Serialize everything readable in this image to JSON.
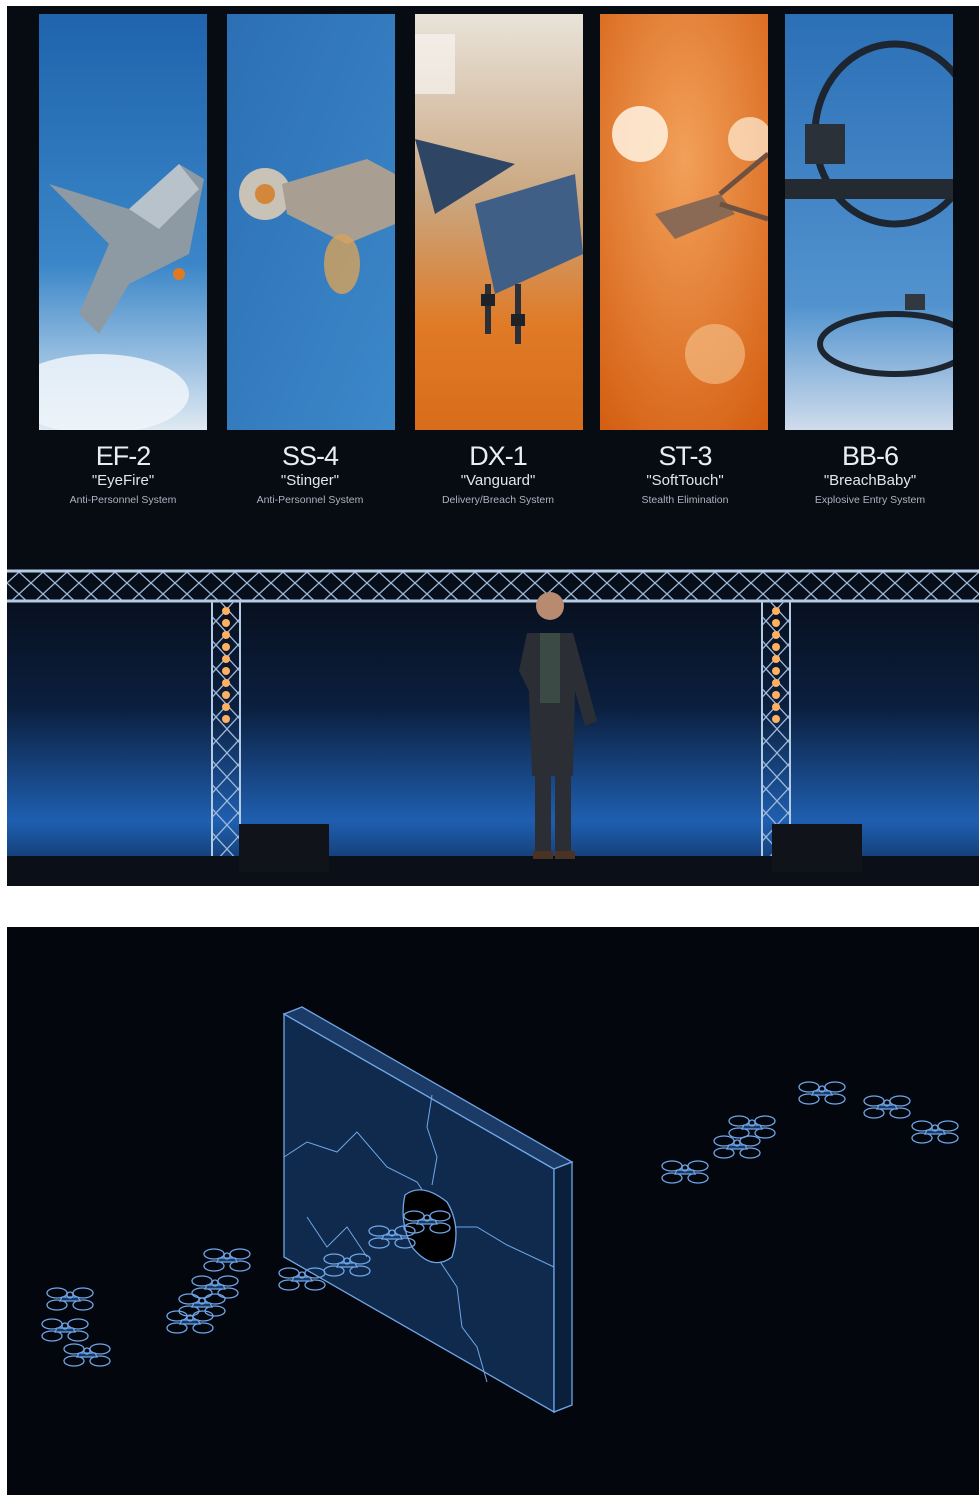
{
  "panels": [
    {
      "code": "EF-2",
      "nickname": "\"EyeFire\"",
      "description": "Anti-Personnel System",
      "bg": "#2a6db0"
    },
    {
      "code": "SS-4",
      "nickname": "\"Stinger\"",
      "description": "Anti-Personnel System",
      "bg": "#2f74b8"
    },
    {
      "code": "DX-1",
      "nickname": "\"Vanguard\"",
      "description": "Delivery/Breach System",
      "bg": "#d9772e"
    },
    {
      "code": "ST-3",
      "nickname": "\"SoftTouch\"",
      "description": "Stealth Elimination",
      "bg": "#e0701f"
    },
    {
      "code": "BB-6",
      "nickname": "\"BreachBaby\"",
      "description": "Explosive Entry System",
      "bg": "#3a7cbf"
    }
  ],
  "colors": {
    "stage_blue": "#1f5fb0",
    "truss": "#9db8d8",
    "light_bulb": "#ffb060",
    "diagram_line": "#6fa6e8"
  },
  "icons": [
    "quadcopter-drone-icon",
    "wall-icon"
  ]
}
